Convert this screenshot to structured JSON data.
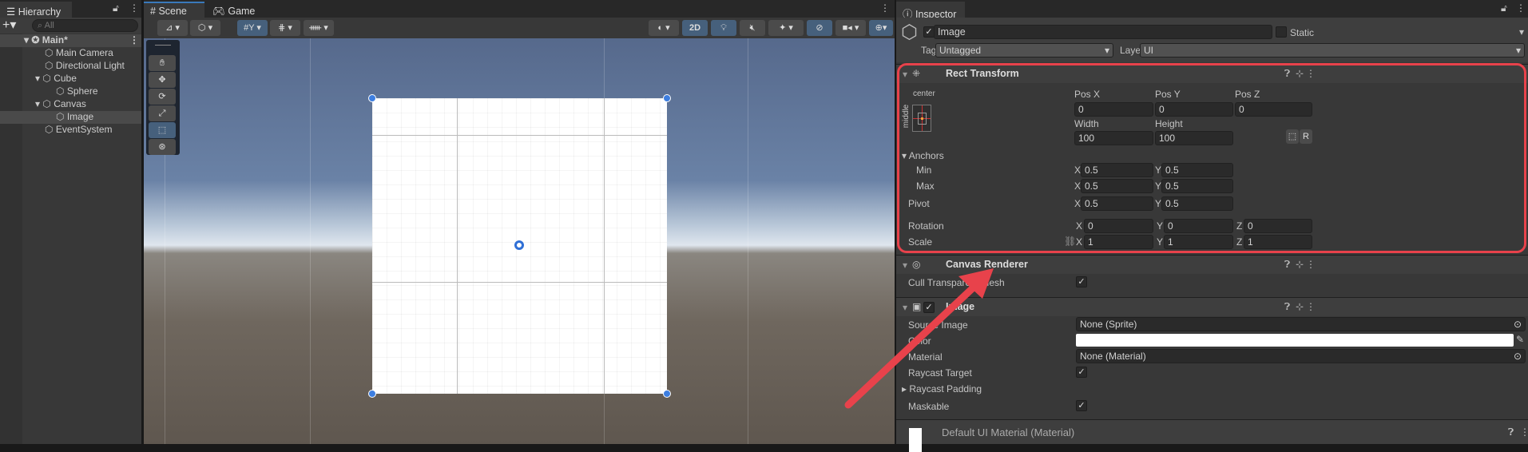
{
  "hierarchy": {
    "title": "Hierarchy",
    "search_placeholder": "All",
    "scene": "Main*",
    "items": [
      {
        "label": "Main Camera"
      },
      {
        "label": "Directional Light"
      },
      {
        "label": "Cube"
      },
      {
        "label": "Sphere"
      },
      {
        "label": "Canvas"
      },
      {
        "label": "Image"
      },
      {
        "label": "EventSystem"
      }
    ]
  },
  "scene_view": {
    "tabs": [
      {
        "label": "Scene"
      },
      {
        "label": "Game"
      }
    ],
    "mode_2d": "2D"
  },
  "inspector": {
    "title": "Inspector",
    "object_name": "Image",
    "static_label": "Static",
    "tag_label": "Tag",
    "tag_value": "Untagged",
    "layer_label": "Layer",
    "layer_value": "UI",
    "rect_transform": {
      "title": "Rect Transform",
      "anchor_h": "center",
      "anchor_v": "middle",
      "pos_x_label": "Pos X",
      "pos_y_label": "Pos Y",
      "pos_z_label": "Pos Z",
      "pos_x": "0",
      "pos_y": "0",
      "pos_z": "0",
      "width_label": "Width",
      "height_label": "Height",
      "width": "100",
      "height": "100",
      "raw_button": "R",
      "anchors_label": "Anchors",
      "min_label": "Min",
      "max_label": "Max",
      "pivot_label": "Pivot",
      "rotation_label": "Rotation",
      "scale_label": "Scale",
      "x": "X",
      "y": "Y",
      "z": "Z",
      "min_x": "0.5",
      "min_y": "0.5",
      "max_x": "0.5",
      "max_y": "0.5",
      "pivot_x": "0.5",
      "pivot_y": "0.5",
      "rot_x": "0",
      "rot_y": "0",
      "rot_z": "0",
      "scale_x": "1",
      "scale_y": "1",
      "scale_z": "1"
    },
    "canvas_renderer": {
      "title": "Canvas Renderer",
      "cull_label": "Cull Transparent Mesh"
    },
    "image": {
      "title": "Image",
      "source_label": "Source Image",
      "source_value": "None (Sprite)",
      "color_label": "Color",
      "color_value": "#ffffff",
      "material_label": "Material",
      "material_value": "None (Material)",
      "raycast_target_label": "Raycast Target",
      "raycast_padding_label": "Raycast Padding",
      "maskable_label": "Maskable"
    },
    "material_footer": "Default UI Material (Material)"
  },
  "colors": {
    "annotation": "#e8424b",
    "accent": "#46607c"
  }
}
